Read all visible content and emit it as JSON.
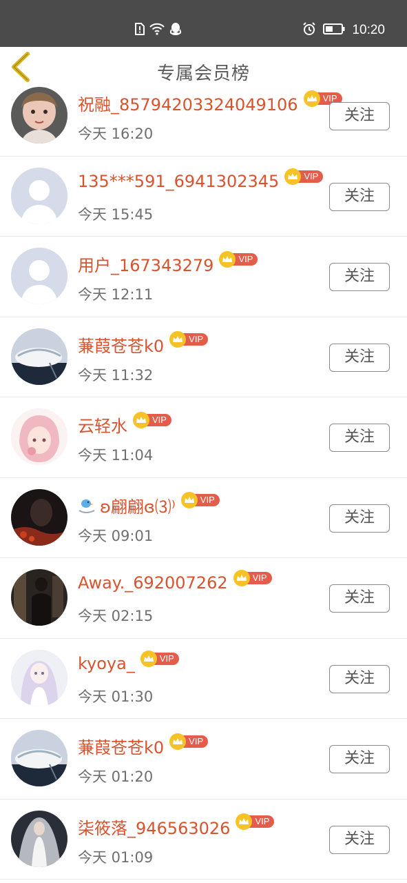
{
  "status_bar": {
    "time": "10:20",
    "left_icons": [
      "sim-alert-icon",
      "wifi-icon",
      "qq-icon"
    ],
    "right_icons": [
      "alarm-icon",
      "battery-icon"
    ]
  },
  "header": {
    "title": "专属会员榜",
    "back_icon": "chevron-left-icon"
  },
  "colors": {
    "name": "#d9532e",
    "vip_crown": "#f5c227",
    "vip_tag": "#e45d4b",
    "back_arrow": "#d9b21f",
    "status_bar": "#4b4b4b"
  },
  "vip_label": "VIP",
  "follow_label": "关注",
  "members": [
    {
      "name": "祝融_85794203324049106",
      "time": "今天 16:20",
      "avatar": "vintage-doll"
    },
    {
      "name": "135***591_6941302345",
      "time": "今天 15:45",
      "avatar": "default-person"
    },
    {
      "name": "用户_167343279",
      "time": "今天 12:11",
      "avatar": "default-person"
    },
    {
      "name": "蒹葭苍苍k0",
      "time": "今天 11:32",
      "avatar": "feather-hat"
    },
    {
      "name": "云轻水",
      "time": "今天 11:04",
      "avatar": "anime-girl-pink"
    },
    {
      "name": "ʚ翩翩ɞ⑶⁾",
      "time": "今天 09:01",
      "avatar": "dark-photo",
      "prefix_icon": "bird-emoji-icon"
    },
    {
      "name": "Away._692007262",
      "time": "今天 02:15",
      "avatar": "dark-figure"
    },
    {
      "name": "kyoya_",
      "time": "今天 01:30",
      "avatar": "anime-girl-white"
    },
    {
      "name": "蒹葭苍苍k0",
      "time": "今天 01:20",
      "avatar": "feather-hat"
    },
    {
      "name": "柒筱落_946563026",
      "time": "今天 01:09",
      "avatar": "bride-veil"
    }
  ]
}
